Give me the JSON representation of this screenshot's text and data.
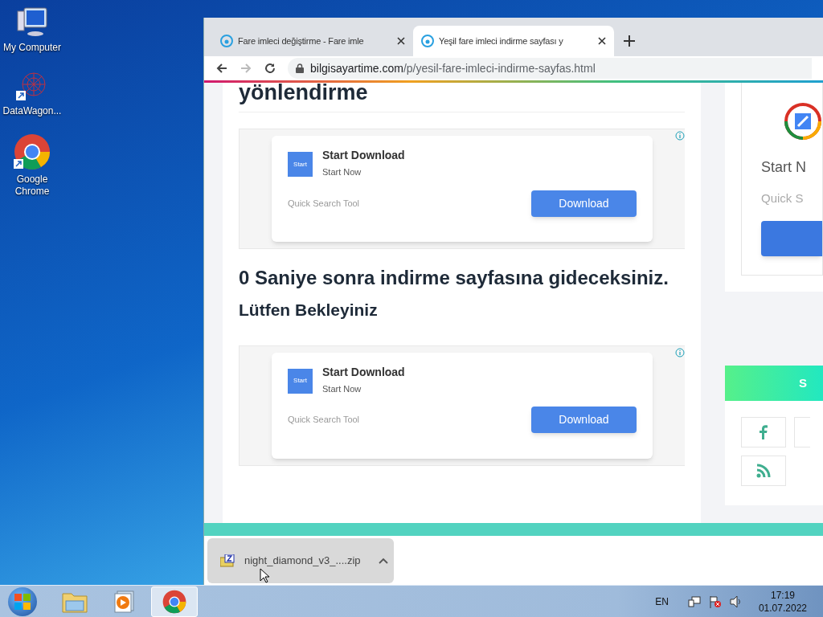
{
  "desktop_icons": [
    {
      "kind": "computer",
      "label": "My Computer"
    },
    {
      "kind": "datawagon",
      "label": "DataWagon..."
    },
    {
      "kind": "chrome",
      "label": "Google Chrome"
    }
  ],
  "browser": {
    "tabs": [
      {
        "title": "Fare imleci değiştirme - Fare imle",
        "selected": false
      },
      {
        "title": "Yeşil fare imleci indirme sayfası y",
        "selected": true
      }
    ],
    "address": {
      "host": "bilgisayartime.com",
      "path": "/p/yesil-fare-imleci-indirme-sayfas.html"
    }
  },
  "page": {
    "heading": "yönlendirme",
    "ads": [
      {
        "logo_text": "Start",
        "title": "Start Download",
        "subtitle": "Start Now",
        "tagline": "Quick Search Tool",
        "button": "Download"
      },
      {
        "logo_text": "Start",
        "title": "Start Download",
        "subtitle": "Start Now",
        "tagline": "Quick Search Tool",
        "button": "Download"
      }
    ],
    "countdown": "0 Saniye sonra indirme sayfasına gideceksiniz.",
    "wait": "Lütfen Bekleyiniz",
    "sidebar": {
      "title": "Start N",
      "tagline": "Quick S",
      "banner": "S"
    }
  },
  "download_bar": {
    "filename": "night_diamond_v3_....zip"
  },
  "taskbar": {
    "apps": [
      {
        "kind": "explorer",
        "selected": false
      },
      {
        "kind": "media",
        "selected": false
      },
      {
        "kind": "chrome",
        "selected": true
      }
    ],
    "language": "EN",
    "time": "17:19",
    "date": "01.07.2022"
  }
}
